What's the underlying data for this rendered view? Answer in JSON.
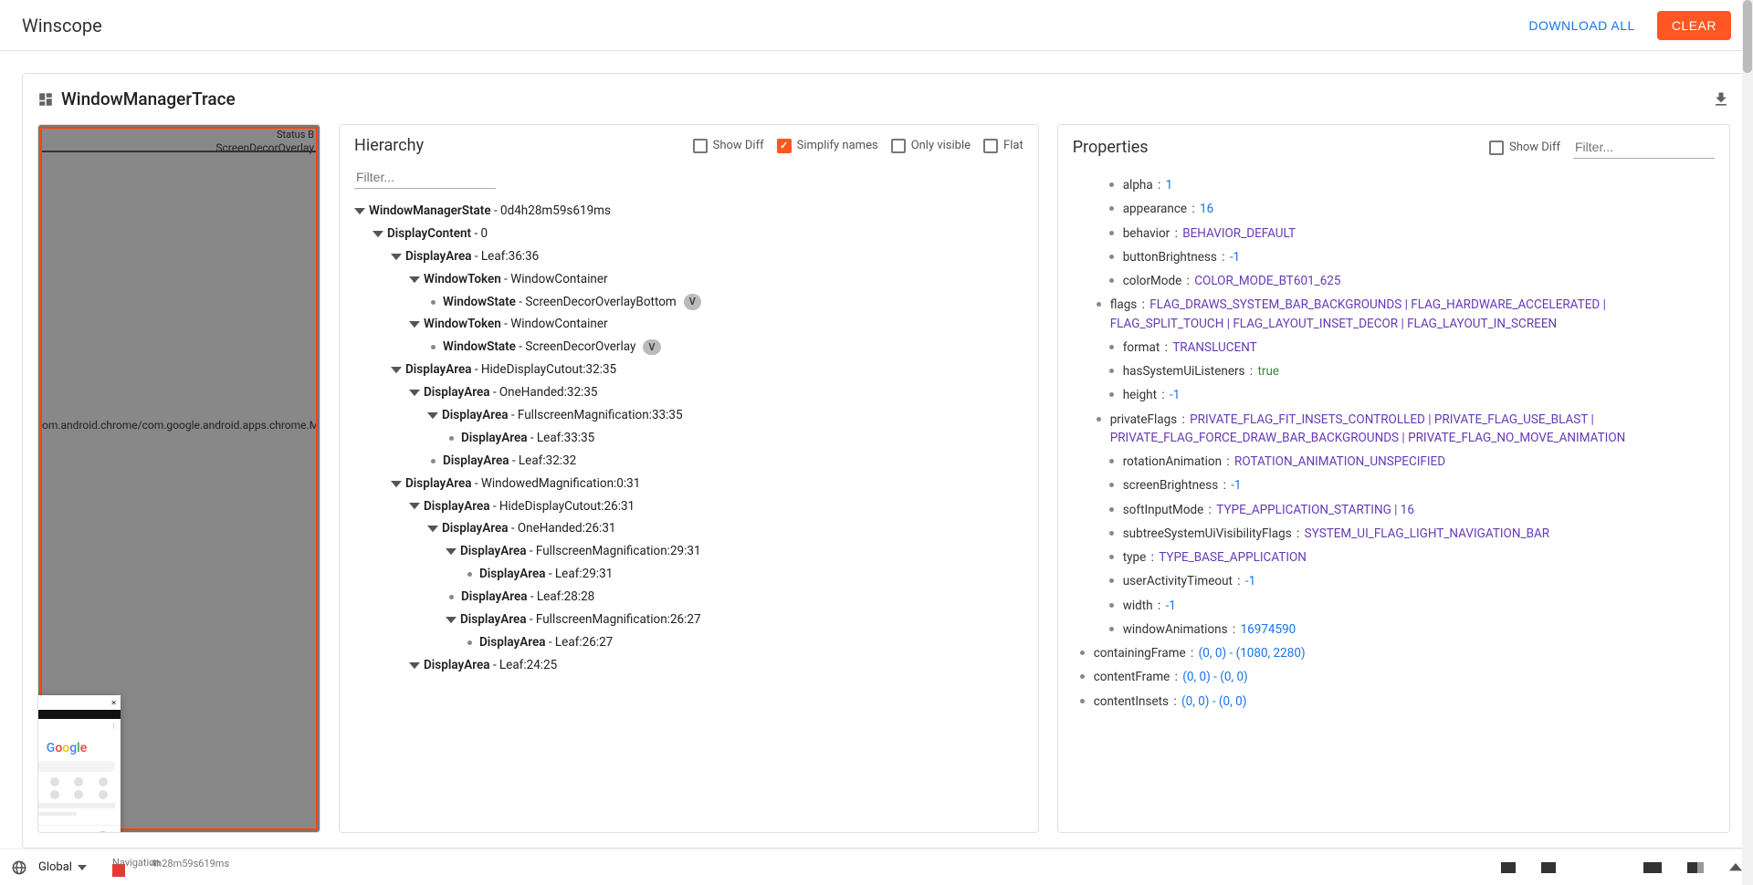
{
  "app": {
    "title": "Winscope"
  },
  "topbar": {
    "download_all": "DOWNLOAD ALL",
    "clear": "CLEAR"
  },
  "trace": {
    "title": "WindowManagerTrace"
  },
  "hierarchy": {
    "title": "Hierarchy",
    "show_diff": "Show Diff",
    "simplify": "Simplify names",
    "only_visible": "Only visible",
    "flat": "Flat",
    "filter_placeholder": "Filter...",
    "tree": {
      "root": {
        "type": "WindowManagerState",
        "suffix": "0d4h28m59s619ms"
      },
      "dc": {
        "type": "DisplayContent",
        "suffix": "0"
      },
      "l3636": {
        "type": "DisplayArea",
        "suffix": "Leaf:36:36"
      },
      "wt1": {
        "type": "WindowToken",
        "suffix": "WindowContainer"
      },
      "ws1": {
        "type": "WindowState",
        "suffix": "ScreenDecorOverlayBottom",
        "chip": "V"
      },
      "wt2": {
        "type": "WindowToken",
        "suffix": "WindowContainer"
      },
      "ws2": {
        "type": "WindowState",
        "suffix": "ScreenDecorOverlay",
        "chip": "V"
      },
      "hdc1": {
        "type": "DisplayArea",
        "suffix": "HideDisplayCutout:32:35"
      },
      "oh1": {
        "type": "DisplayArea",
        "suffix": "OneHanded:32:35"
      },
      "fm1": {
        "type": "DisplayArea",
        "suffix": "FullscreenMagnification:33:35"
      },
      "l3335": {
        "type": "DisplayArea",
        "suffix": "Leaf:33:35"
      },
      "l3232": {
        "type": "DisplayArea",
        "suffix": "Leaf:32:32"
      },
      "wm": {
        "type": "DisplayArea",
        "suffix": "WindowedMagnification:0:31"
      },
      "hdc2": {
        "type": "DisplayArea",
        "suffix": "HideDisplayCutout:26:31"
      },
      "oh2": {
        "type": "DisplayArea",
        "suffix": "OneHanded:26:31"
      },
      "fm2": {
        "type": "DisplayArea",
        "suffix": "FullscreenMagnification:29:31"
      },
      "l2931": {
        "type": "DisplayArea",
        "suffix": "Leaf:29:31"
      },
      "l2828": {
        "type": "DisplayArea",
        "suffix": "Leaf:28:28"
      },
      "fm3": {
        "type": "DisplayArea",
        "suffix": "FullscreenMagnification:26:27"
      },
      "l2627": {
        "type": "DisplayArea",
        "suffix": "Leaf:26:27"
      },
      "l2425": {
        "type": "DisplayArea",
        "suffix": "Leaf:24:25"
      }
    }
  },
  "properties": {
    "title": "Properties",
    "show_diff": "Show Diff",
    "filter_placeholder": "Filter...",
    "items": [
      {
        "indent": 2,
        "key": "alpha",
        "value": "1",
        "style": "num"
      },
      {
        "indent": 2,
        "key": "appearance",
        "value": "16",
        "style": "num"
      },
      {
        "indent": 2,
        "key": "behavior",
        "value": "BEHAVIOR_DEFAULT",
        "style": "purple"
      },
      {
        "indent": 2,
        "key": "buttonBrightness",
        "value": "-1",
        "style": "num"
      },
      {
        "indent": 2,
        "key": "colorMode",
        "value": "COLOR_MODE_BT601_625",
        "style": "purple"
      },
      {
        "indent": 1,
        "key": "flags",
        "value": "FLAG_DRAWS_SYSTEM_BAR_BACKGROUNDS | FLAG_HARDWARE_ACCELERATED | FLAG_SPLIT_TOUCH | FLAG_LAYOUT_INSET_DECOR | FLAG_LAYOUT_IN_SCREEN",
        "style": "purple"
      },
      {
        "indent": 2,
        "key": "format",
        "value": "TRANSLUCENT",
        "style": "purple"
      },
      {
        "indent": 2,
        "key": "hasSystemUiListeners",
        "value": "true",
        "style": "green"
      },
      {
        "indent": 2,
        "key": "height",
        "value": "-1",
        "style": "num"
      },
      {
        "indent": 1,
        "key": "privateFlags",
        "value": "PRIVATE_FLAG_FIT_INSETS_CONTROLLED | PRIVATE_FLAG_USE_BLAST | PRIVATE_FLAG_FORCE_DRAW_BAR_BACKGROUNDS | PRIVATE_FLAG_NO_MOVE_ANIMATION",
        "style": "purple"
      },
      {
        "indent": 2,
        "key": "rotationAnimation",
        "value": "ROTATION_ANIMATION_UNSPECIFIED",
        "style": "purple"
      },
      {
        "indent": 2,
        "key": "screenBrightness",
        "value": "-1",
        "style": "num"
      },
      {
        "indent": 2,
        "key": "softInputMode",
        "value": "TYPE_APPLICATION_STARTING | 16",
        "style": "purple"
      },
      {
        "indent": 2,
        "key": "subtreeSystemUiVisibilityFlags",
        "value": "SYSTEM_UI_FLAG_LIGHT_NAVIGATION_BAR",
        "style": "purple"
      },
      {
        "indent": 2,
        "key": "type",
        "value": "TYPE_BASE_APPLICATION",
        "style": "purple"
      },
      {
        "indent": 2,
        "key": "userActivityTimeout",
        "value": "-1",
        "style": "num"
      },
      {
        "indent": 2,
        "key": "width",
        "value": "-1",
        "style": "num"
      },
      {
        "indent": 2,
        "key": "windowAnimations",
        "value": "16974590",
        "style": "num"
      },
      {
        "indent": 0,
        "key": "containingFrame",
        "value": "(0, 0) - (1080, 2280)",
        "style": "num"
      },
      {
        "indent": 0,
        "key": "contentFrame",
        "value": "(0, 0) - (0, 0)",
        "style": "num"
      },
      {
        "indent": 0,
        "key": "contentInsets",
        "value": "(0, 0) - (0, 0)",
        "style": "num"
      }
    ]
  },
  "preview": {
    "status": "Status B",
    "screen_label": "ScreenDecorOverlay",
    "chrome_label": "om.android.chrome/com.google.android.apps.chrome.Main"
  },
  "bottombar": {
    "global": "Global",
    "nav_label": "Navigation",
    "timestamp": "4h28m59s619ms"
  }
}
